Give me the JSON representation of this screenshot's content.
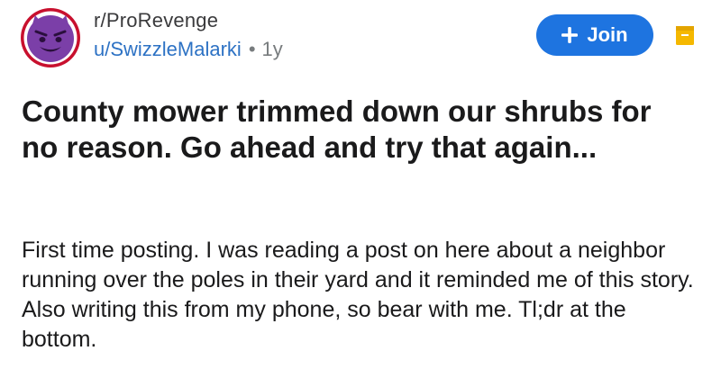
{
  "header": {
    "subreddit": "r/ProRevenge",
    "username": "u/SwizzleMalarki",
    "separator": "•",
    "age": "1y",
    "join_label": "Join"
  },
  "post": {
    "title": "County mower trimmed down our shrubs for no reason. Go ahead and try that again...",
    "body": "First time posting. I was reading a post on here about a neighbor running over the poles in their yard and it reminded me of this story. Also writing this from my phone, so bear with me. Tl;dr at the bottom."
  },
  "icons": {
    "avatar": "devil-face-icon",
    "join": "plus-icon",
    "save": "folder-icon"
  },
  "colors": {
    "join_button": "#1e74e0",
    "username": "#2d72c4",
    "avatar_face": "#7b3fa8",
    "avatar_ring": "#c8102e",
    "folder": "#f5b800"
  }
}
